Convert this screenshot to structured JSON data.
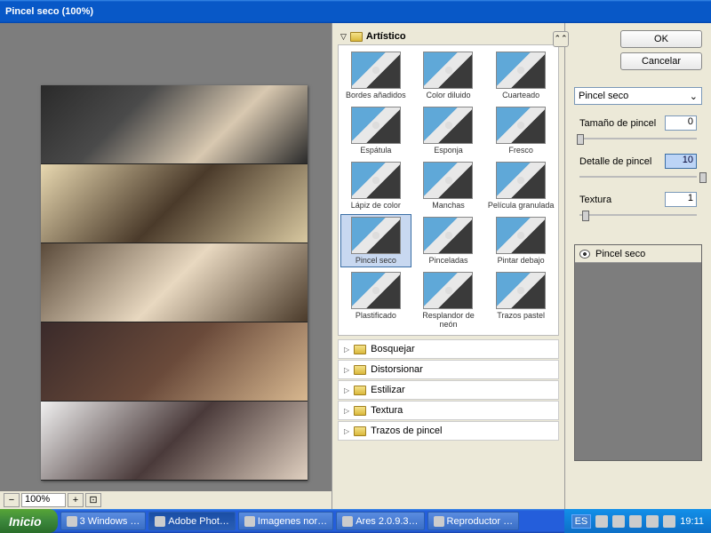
{
  "titlebar": {
    "title": "Pincel seco (100%)"
  },
  "zoom": {
    "minus": "−",
    "plus": "+",
    "value": "100%",
    "fit": "⊡"
  },
  "filters": {
    "expanded_category": "Artístico",
    "items": [
      {
        "label": "Bordes añadidos"
      },
      {
        "label": "Color diluido"
      },
      {
        "label": "Cuarteado"
      },
      {
        "label": "Espátula"
      },
      {
        "label": "Esponja"
      },
      {
        "label": "Fresco"
      },
      {
        "label": "Lápiz de color"
      },
      {
        "label": "Manchas"
      },
      {
        "label": "Película granulada"
      },
      {
        "label": "Pincel seco"
      },
      {
        "label": "Pinceladas"
      },
      {
        "label": "Pintar debajo"
      },
      {
        "label": "Plastificado"
      },
      {
        "label": "Resplandor de neón"
      },
      {
        "label": "Trazos pastel"
      }
    ],
    "selected_index": 9,
    "categories": [
      "Bosquejar",
      "Distorsionar",
      "Estilizar",
      "Textura",
      "Trazos de pincel"
    ]
  },
  "buttons": {
    "ok": "OK",
    "cancel": "Cancelar",
    "expand": "⌃⌃"
  },
  "settings": {
    "current_filter": "Pincel seco",
    "params": [
      {
        "label": "Tamaño de pincel",
        "value": "0",
        "pct": 2
      },
      {
        "label": "Detalle de pincel",
        "value": "10",
        "pct": 98,
        "hl": true
      },
      {
        "label": "Textura",
        "value": "1",
        "pct": 6
      }
    ]
  },
  "layers": {
    "item": "Pincel seco"
  },
  "taskbar": {
    "start": "Inicio",
    "items": [
      "3 Windows …",
      "Adobe Phot…",
      "Imagenes nor…",
      "Ares 2.0.9.3…",
      "Reproductor …"
    ],
    "lang": "ES",
    "clock": "19:11"
  }
}
